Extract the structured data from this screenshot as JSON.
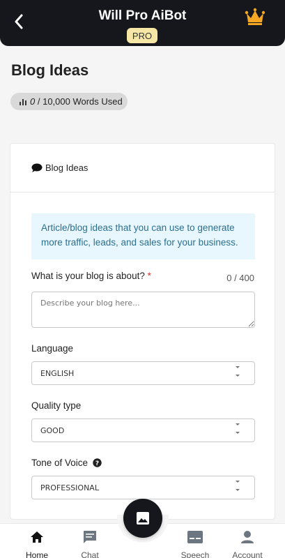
{
  "header": {
    "title": "Will Pro AiBot",
    "badge": "PRO",
    "back_icon": "chevron-left-icon",
    "crown_icon": "crown-icon",
    "bg_color": "#15171c",
    "crown_color": "#f5a623"
  },
  "page": {
    "title": "Blog Ideas",
    "words_used": "0",
    "words_total": "/ 10,000 Words Used"
  },
  "card": {
    "heading": "Blog Ideas",
    "info": "Article/blog ideas that you can use to generate more traffic, leads, and sales for your business.",
    "info_color": "#e8f6fd"
  },
  "form": {
    "topic_label": "What is your blog is about?",
    "required_mark": "*",
    "counter": "0 / 400",
    "topic_placeholder": "Describe your blog here...",
    "language_label": "Language",
    "language_value": "ENGLISH",
    "quality_label": "Quality type",
    "quality_value": "GOOD",
    "tone_label": "Tone of Voice",
    "tone_value": "PROFESSIONAL"
  },
  "nav": {
    "items": [
      {
        "label": "Home",
        "icon": "home-icon",
        "active": true
      },
      {
        "label": "Chat",
        "icon": "chat-icon",
        "active": false
      },
      {
        "label": "Speech",
        "icon": "speech-icon",
        "active": false
      },
      {
        "label": "Account",
        "icon": "account-icon",
        "active": false
      }
    ],
    "fab_icon": "image-icon"
  }
}
